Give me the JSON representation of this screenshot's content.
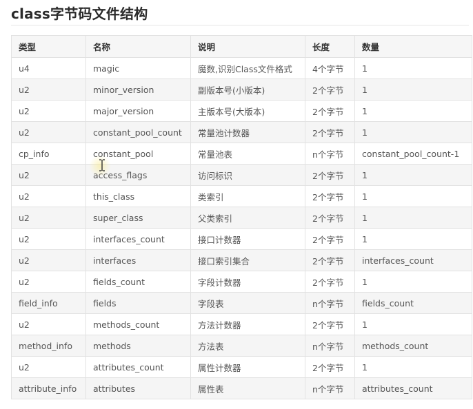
{
  "title": "class字节码文件结构",
  "table": {
    "headers": [
      "类型",
      "名称",
      "说明",
      "长度",
      "数量"
    ],
    "rows": [
      [
        "u4",
        "magic",
        "魔数,识别Class文件格式",
        "4个字节",
        "1"
      ],
      [
        "u2",
        "minor_version",
        "副版本号(小版本)",
        "2个字节",
        "1"
      ],
      [
        "u2",
        "major_version",
        "主版本号(大版本)",
        "2个字节",
        "1"
      ],
      [
        "u2",
        "constant_pool_count",
        "常量池计数器",
        "2个字节",
        "1"
      ],
      [
        "cp_info",
        "constant_pool",
        "常量池表",
        "n个字节",
        "constant_pool_count-1"
      ],
      [
        "u2",
        "access_flags",
        "访问标识",
        "2个字节",
        "1"
      ],
      [
        "u2",
        "this_class",
        "类索引",
        "2个字节",
        "1"
      ],
      [
        "u2",
        "super_class",
        "父类索引",
        "2个字节",
        "1"
      ],
      [
        "u2",
        "interfaces_count",
        "接口计数器",
        "2个字节",
        "1"
      ],
      [
        "u2",
        "interfaces",
        "接口索引集合",
        "2个字节",
        "interfaces_count"
      ],
      [
        "u2",
        "fields_count",
        "字段计数器",
        "2个字节",
        "1"
      ],
      [
        "field_info",
        "fields",
        "字段表",
        "n个字节",
        "fields_count"
      ],
      [
        "u2",
        "methods_count",
        "方法计数器",
        "2个字节",
        "1"
      ],
      [
        "method_info",
        "methods",
        "方法表",
        "n个字节",
        "methods_count"
      ],
      [
        "u2",
        "attributes_count",
        "属性计数器",
        "2个字节",
        "1"
      ],
      [
        "attribute_info",
        "attributes",
        "属性表",
        "n个字节",
        "attributes_count"
      ]
    ]
  },
  "cursor": {
    "icon": "text-cursor-icon"
  }
}
